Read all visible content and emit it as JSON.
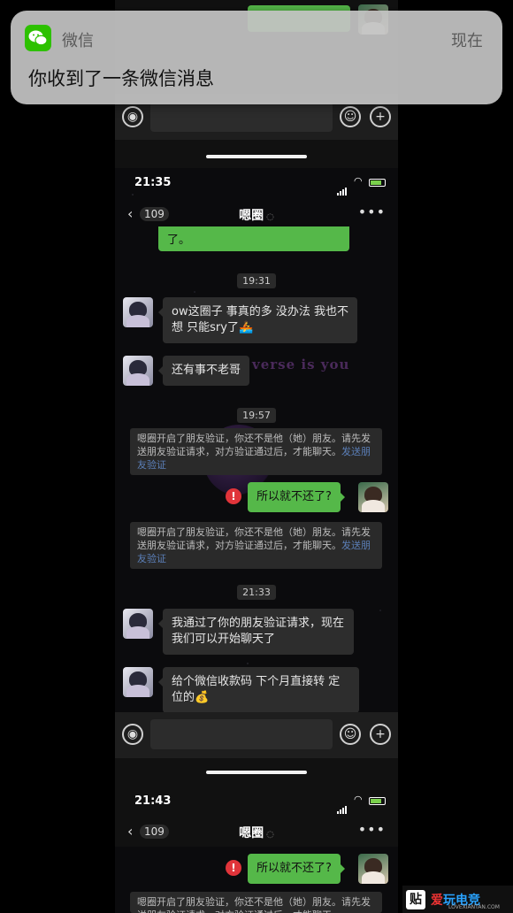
{
  "notification": {
    "app_name": "微信",
    "time": "现在",
    "message": "你收到了一条微信消息"
  },
  "screen1": {
    "time": "21:35",
    "back_count": "109",
    "chat_title": "嗯圈",
    "messages": [
      {
        "time": "19:31"
      },
      {
        "text": "ow这圈子 事真的多 没办法 我也不想 只能sry了🚣"
      },
      {
        "text": "还有事不老哥"
      },
      {
        "time": "19:57"
      },
      {
        "sys_text": "嗯圈开启了朋友验证，你还不是他（她）朋友。请先发送朋友验证请求，对方验证通过后，才能聊天。",
        "sys_link": "发送朋友验证"
      },
      {
        "text": "所以就不还了?"
      },
      {
        "sys_text": "嗯圈开启了朋友验证，你还不是他（她）朋友。请先发送朋友验证请求，对方验证通过后，才能聊天。",
        "sys_link": "发送朋友验证"
      },
      {
        "time": "21:33"
      },
      {
        "text": "我通过了你的朋友验证请求，现在我们可以开始聊天了"
      },
      {
        "text": "给个微信收款码 下个月直接转 定位的💰"
      }
    ],
    "watermark": "verse is you"
  },
  "screen2": {
    "time": "21:43",
    "back_count": "109",
    "chat_title": "嗯圈",
    "out_message": "所以就不还了?",
    "sys_partial": "嗯圈开启了朋友验证，你还不是他（她）朋友。请先发送朋友验证请求，对方验证通过后，才能聊天。"
  },
  "brand": {
    "tie": "贴",
    "logo_a": "爱",
    "logo_b": "玩电竞",
    "sub": "LOVEXIANTAN.COM"
  },
  "icons": [
    "voice-icon",
    "emoji-icon",
    "plus-icon",
    "back-chevron-icon",
    "more-icon",
    "error-icon",
    "wechat-icon"
  ]
}
